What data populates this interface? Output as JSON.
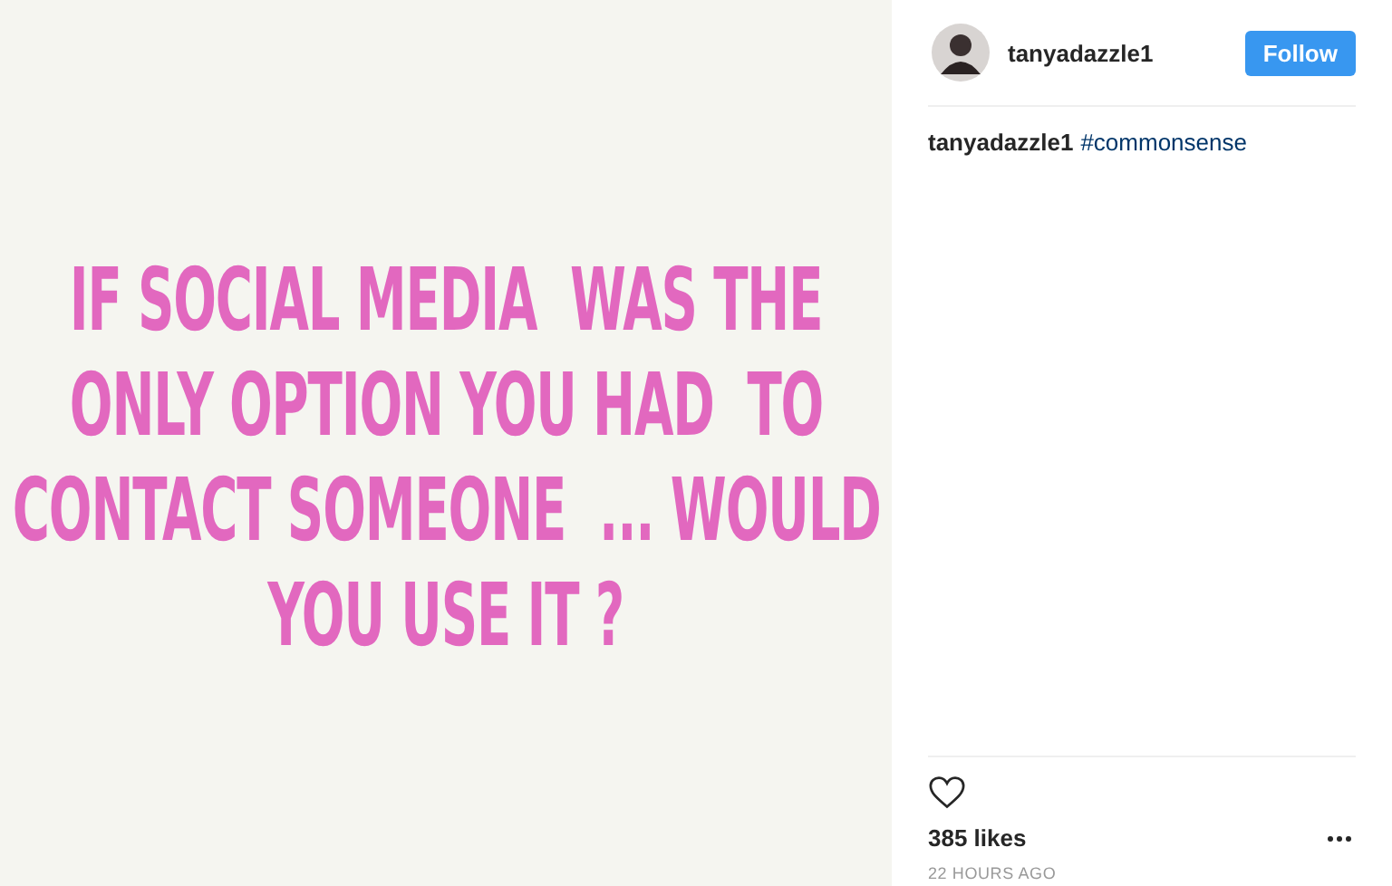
{
  "post_image": {
    "lines": [
      "IF SOCIAL MEDIA  WAS THE",
      "ONLY OPTION YOU HAD  TO",
      "CONTACT SOMEONE  ... WOULD",
      "YOU USE IT ?"
    ]
  },
  "header": {
    "username": "tanyadazzle1",
    "follow_button": "Follow"
  },
  "caption": {
    "username": "tanyadazzle1",
    "hashtag": "#commonsense"
  },
  "likes": "385 likes",
  "timestamp": "22 HOURS AGO"
}
